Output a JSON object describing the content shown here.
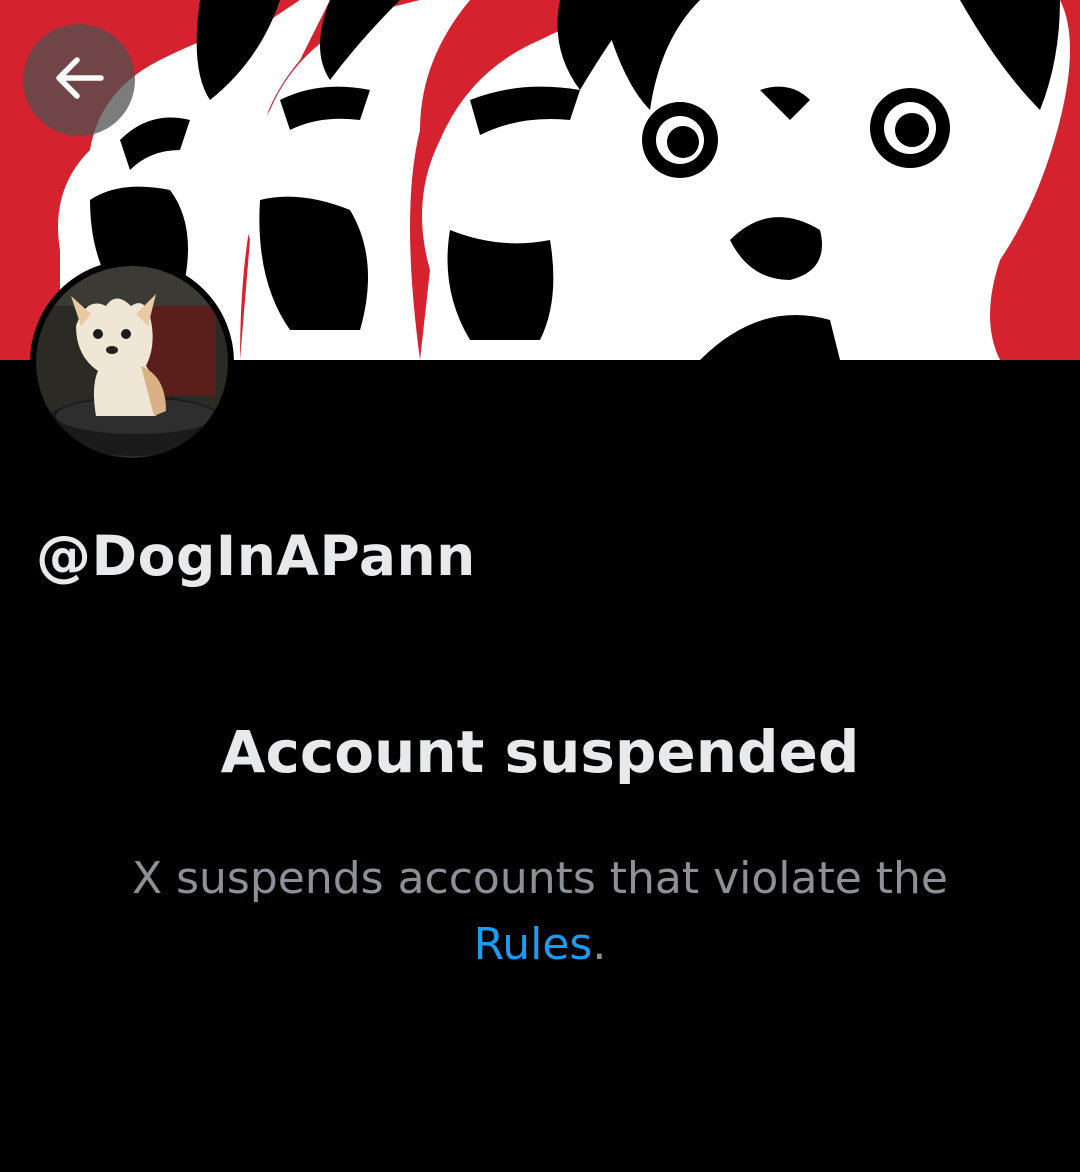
{
  "profile": {
    "handle": "@DogInAPann"
  },
  "suspension": {
    "title": "Account suspended",
    "message_before_link": "X suspends accounts that violate the",
    "link_label": "Rules",
    "message_after_link": "."
  },
  "icons": {
    "back": "arrow-left-icon"
  },
  "colors": {
    "background": "#000000",
    "banner_red": "#d4232f",
    "primary_text": "#e7e9ea",
    "secondary_text": "#8b9196",
    "link": "#1d9bf0"
  }
}
